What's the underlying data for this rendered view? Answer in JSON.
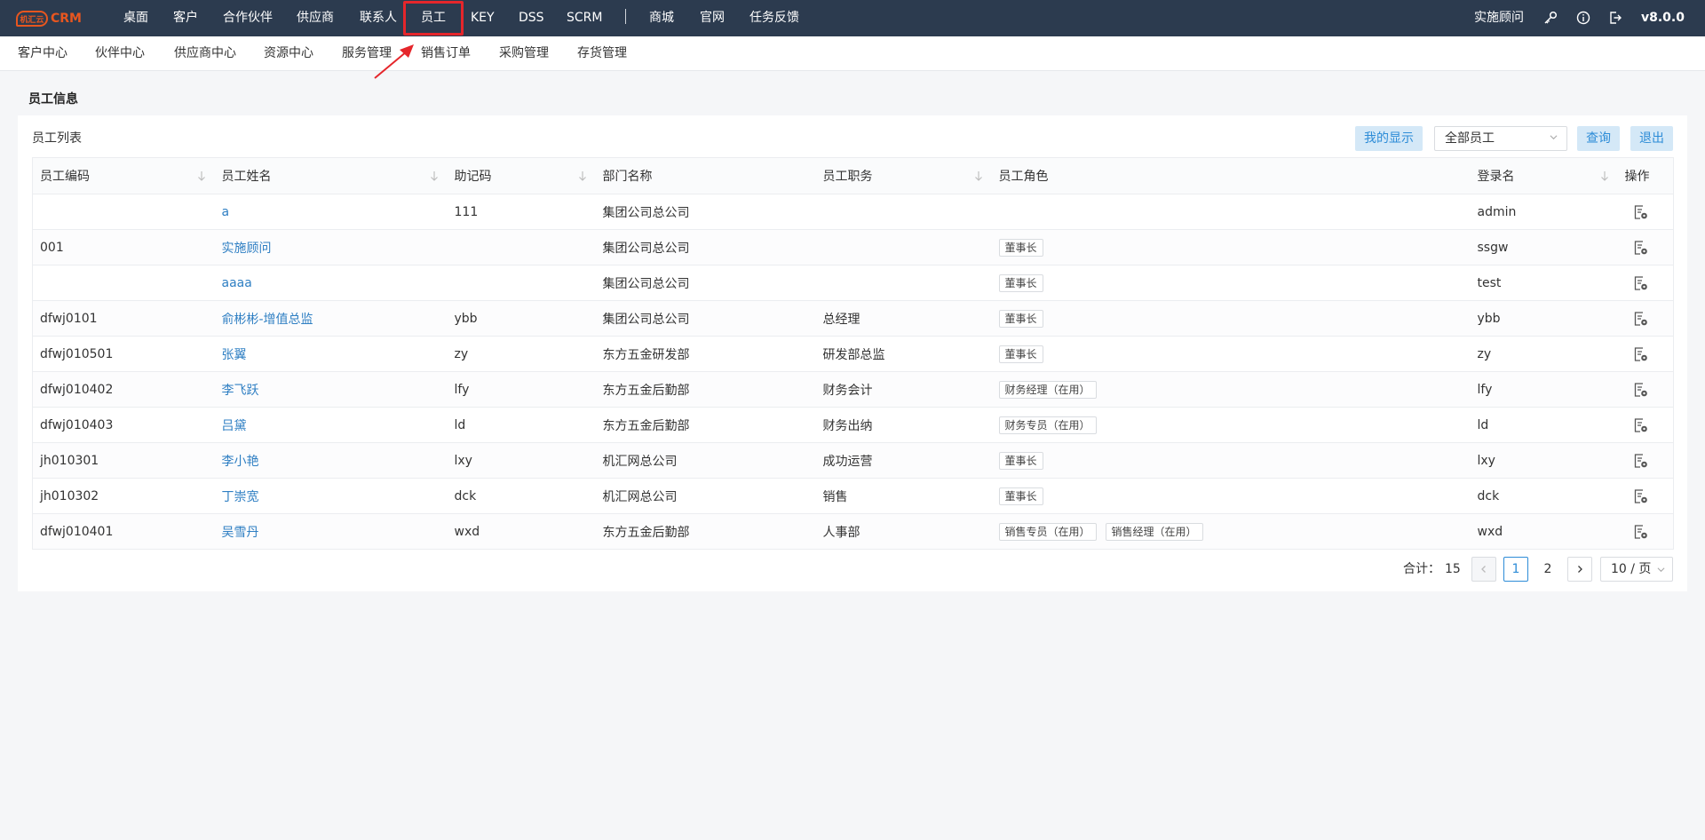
{
  "app": {
    "logo_mark": "机汇云",
    "logo_text": "CRM"
  },
  "topnav": {
    "items": [
      {
        "key": "desktop",
        "label": "桌面"
      },
      {
        "key": "customer",
        "label": "客户"
      },
      {
        "key": "partner",
        "label": "合作伙伴"
      },
      {
        "key": "supplier",
        "label": "供应商"
      },
      {
        "key": "contact",
        "label": "联系人"
      },
      {
        "key": "employee",
        "label": "员工"
      },
      {
        "key": "key",
        "label": "KEY"
      },
      {
        "key": "dss",
        "label": "DSS"
      },
      {
        "key": "scrm",
        "label": "SCRM"
      },
      {
        "key": "mall",
        "label": "商城"
      },
      {
        "key": "website",
        "label": "官网"
      },
      {
        "key": "feedback",
        "label": "任务反馈"
      }
    ],
    "user": "实施顾问",
    "version": "v8.0.0",
    "icons": [
      "key-icon",
      "info-icon",
      "logout-icon"
    ]
  },
  "subnav": {
    "items": [
      "客户中心",
      "伙伴中心",
      "供应商中心",
      "资源中心",
      "服务管理",
      "销售订单",
      "采购管理",
      "存货管理"
    ]
  },
  "section_title": "员工信息",
  "card": {
    "title": "员工列表",
    "my_display_label": "我的显示",
    "filter_value": "全部员工",
    "query_label": "查询",
    "exit_label": "退出"
  },
  "table": {
    "headers": [
      "员工编码",
      "员工姓名",
      "助记码",
      "部门名称",
      "员工职务",
      "员工角色",
      "登录名",
      "操作"
    ],
    "rows": [
      {
        "code": "",
        "name": "a",
        "mnemonic": "111",
        "dept": "集团公司总公司",
        "position": "",
        "roles": [],
        "login": "admin"
      },
      {
        "code": "001",
        "name": "实施顾问",
        "mnemonic": "",
        "dept": "集团公司总公司",
        "position": "",
        "roles": [
          "董事长"
        ],
        "login": "ssgw"
      },
      {
        "code": "",
        "name": "aaaa",
        "mnemonic": "",
        "dept": "集团公司总公司",
        "position": "",
        "roles": [
          "董事长"
        ],
        "login": "test"
      },
      {
        "code": "dfwj0101",
        "name": "俞彬彬-增值总监",
        "mnemonic": "ybb",
        "dept": "集团公司总公司",
        "position": "总经理",
        "roles": [
          "董事长"
        ],
        "login": "ybb"
      },
      {
        "code": "dfwj010501",
        "name": "张翼",
        "mnemonic": "zy",
        "dept": "东方五金研发部",
        "position": "研发部总监",
        "roles": [
          "董事长"
        ],
        "login": "zy"
      },
      {
        "code": "dfwj010402",
        "name": "李飞跃",
        "mnemonic": "lfy",
        "dept": "东方五金后勤部",
        "position": "财务会计",
        "roles": [
          "财务经理（在用）"
        ],
        "login": "lfy"
      },
      {
        "code": "dfwj010403",
        "name": "吕黛",
        "mnemonic": "ld",
        "dept": "东方五金后勤部",
        "position": "财务出纳",
        "roles": [
          "财务专员（在用）"
        ],
        "login": "ld"
      },
      {
        "code": "jh010301",
        "name": "李小艳",
        "mnemonic": "lxy",
        "dept": "机汇网总公司",
        "position": "成功运营",
        "roles": [
          "董事长"
        ],
        "login": "lxy"
      },
      {
        "code": "jh010302",
        "name": "丁崇宽",
        "mnemonic": "dck",
        "dept": "机汇网总公司",
        "position": "销售",
        "roles": [
          "董事长"
        ],
        "login": "dck"
      },
      {
        "code": "dfwj010401",
        "name": "吴雪丹",
        "mnemonic": "wxd",
        "dept": "东方五金后勤部",
        "position": "人事部",
        "roles": [
          "销售专员（在用）",
          "销售经理（在用）"
        ],
        "login": "wxd"
      }
    ]
  },
  "pagination": {
    "total_label": "合计：",
    "total": "15",
    "current_page": "1",
    "pages": [
      "1",
      "2"
    ],
    "page_size": "10 / 页"
  },
  "colors": {
    "topbar": "#2c3b4f",
    "accent": "#2d8cd7",
    "link": "#2f7fc3",
    "highlight": "#e5262b"
  }
}
